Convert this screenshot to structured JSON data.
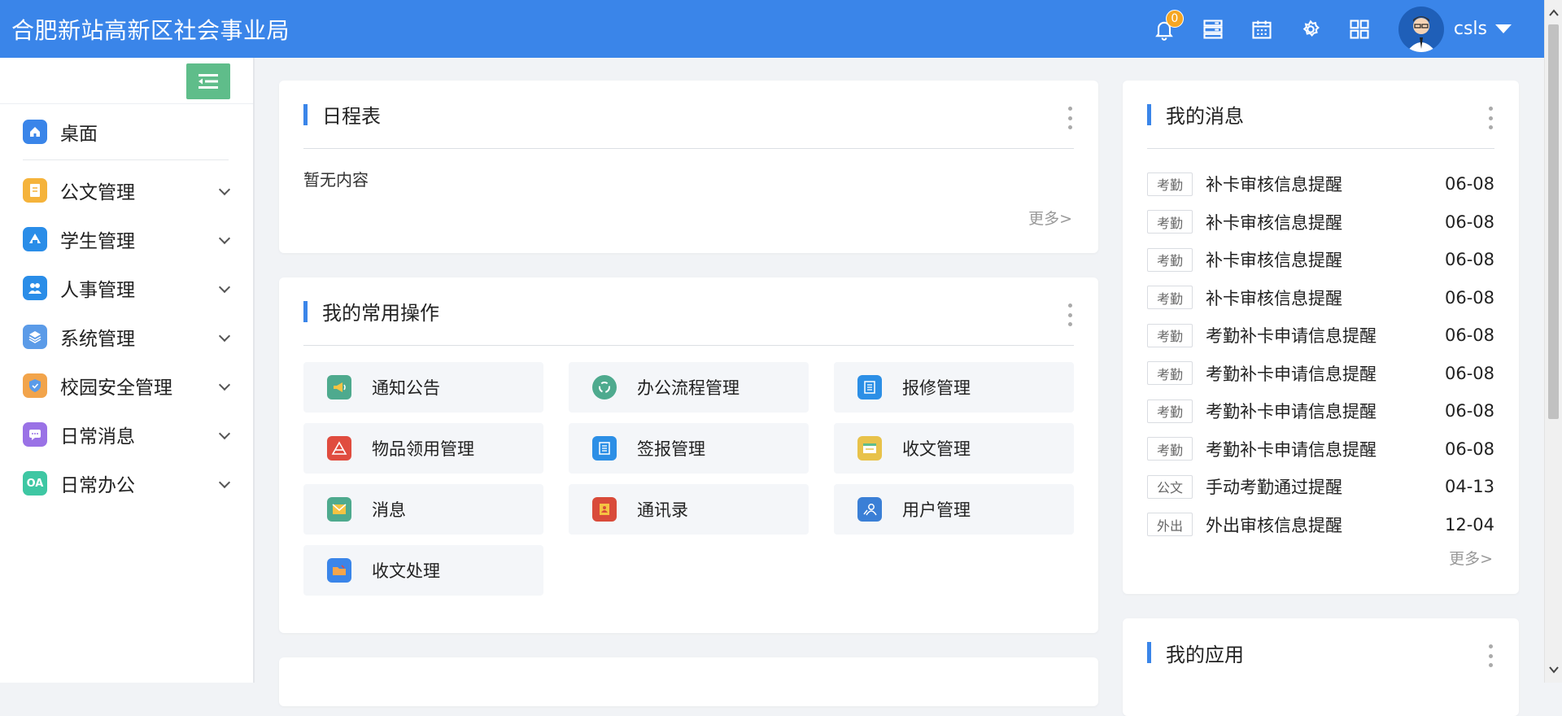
{
  "header": {
    "title": "合肥新站高新区社会事业局",
    "notification_count": "0",
    "username": "csls",
    "icons": [
      "bell-icon",
      "server-icon",
      "calendar-icon",
      "gear-icon",
      "grid-icon"
    ]
  },
  "sidebar": {
    "items": [
      {
        "label": "桌面",
        "icon": "home-icon",
        "color": "#3a85e9"
      },
      {
        "label": "公文管理",
        "icon": "document-icon",
        "color": "#f5b33b"
      },
      {
        "label": "学生管理",
        "icon": "student-icon",
        "color": "#2a8de8"
      },
      {
        "label": "人事管理",
        "icon": "people-icon",
        "color": "#2a8de8"
      },
      {
        "label": "系统管理",
        "icon": "layers-icon",
        "color": "#5b9be8"
      },
      {
        "label": "校园安全管理",
        "icon": "shield-icon",
        "color": "#f2a44b"
      },
      {
        "label": "日常消息",
        "icon": "chat-icon",
        "color": "#9a72e6"
      },
      {
        "label": "日常办公",
        "icon": "oa-icon",
        "color": "#3ec7a3",
        "text": "OA"
      }
    ]
  },
  "schedule": {
    "title": "日程表",
    "empty_text": "暂无内容",
    "more": "更多>"
  },
  "ops": {
    "title": "我的常用操作",
    "items": [
      {
        "label": "通知公告",
        "icon": "megaphone-icon",
        "color": "#4eaa8e"
      },
      {
        "label": "办公流程管理",
        "icon": "workflow-icon",
        "color": "#4eaa8e"
      },
      {
        "label": "报修管理",
        "icon": "repair-icon",
        "color": "#2c8fe6"
      },
      {
        "label": "物品领用管理",
        "icon": "goods-icon",
        "color": "#e04c3f"
      },
      {
        "label": "签报管理",
        "icon": "report-icon",
        "color": "#2c8fe6"
      },
      {
        "label": "收文管理",
        "icon": "inbox-icon",
        "color": "#e8c24a"
      },
      {
        "label": "消息",
        "icon": "mail-icon",
        "color": "#4eaa8e"
      },
      {
        "label": "通讯录",
        "icon": "contacts-icon",
        "color": "#d94b3a"
      },
      {
        "label": "用户管理",
        "icon": "user-admin-icon",
        "color": "#3a7fd6"
      },
      {
        "label": "收文处理",
        "icon": "folder-icon",
        "color": "#3a85e9"
      }
    ]
  },
  "messages": {
    "title": "我的消息",
    "more": "更多>",
    "items": [
      {
        "tag": "考勤",
        "title": "补卡审核信息提醒",
        "date": "06-08"
      },
      {
        "tag": "考勤",
        "title": "补卡审核信息提醒",
        "date": "06-08"
      },
      {
        "tag": "考勤",
        "title": "补卡审核信息提醒",
        "date": "06-08"
      },
      {
        "tag": "考勤",
        "title": "补卡审核信息提醒",
        "date": "06-08"
      },
      {
        "tag": "考勤",
        "title": "考勤补卡申请信息提醒",
        "date": "06-08"
      },
      {
        "tag": "考勤",
        "title": "考勤补卡申请信息提醒",
        "date": "06-08"
      },
      {
        "tag": "考勤",
        "title": "考勤补卡申请信息提醒",
        "date": "06-08"
      },
      {
        "tag": "考勤",
        "title": "考勤补卡申请信息提醒",
        "date": "06-08"
      },
      {
        "tag": "公文",
        "title": "手动考勤通过提醒",
        "date": "04-13"
      },
      {
        "tag": "外出",
        "title": "外出审核信息提醒",
        "date": "12-04"
      }
    ]
  },
  "apps": {
    "title": "我的应用"
  },
  "colors": {
    "header_bg": "#3a85e9",
    "accent": "#3a85e9",
    "toggle_bg": "#5fbd8a"
  }
}
